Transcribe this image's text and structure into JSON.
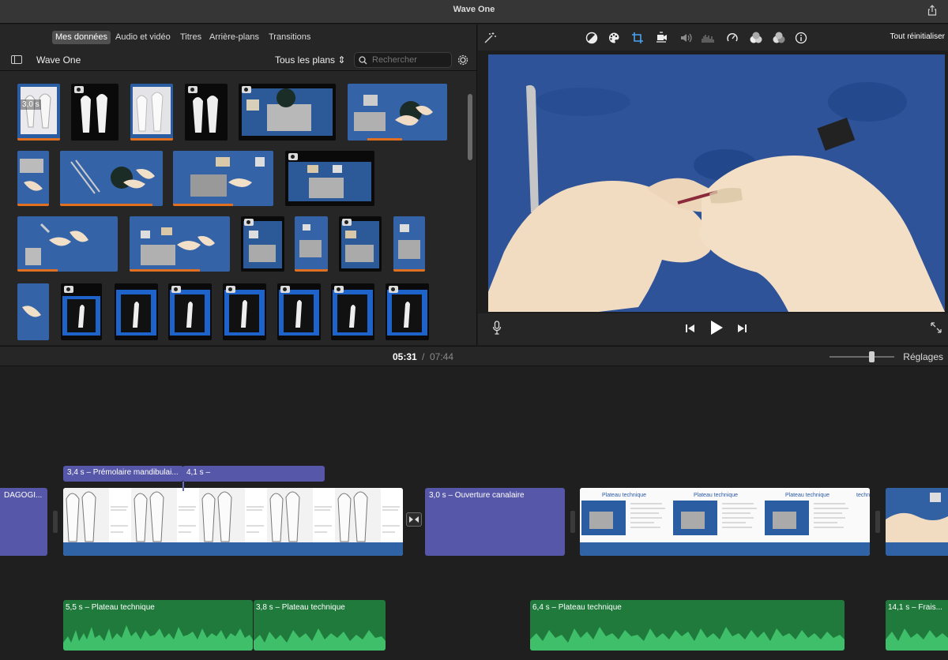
{
  "window": {
    "title": "Wave One"
  },
  "browser": {
    "tabs": [
      "Mes données",
      "Audio et vidéo",
      "Titres",
      "Arrière-plans",
      "Transitions"
    ],
    "active_tab": 0,
    "library_name": "Wave One",
    "filter_label": "Tous les plans",
    "search_placeholder": "Rechercher",
    "first_clip_duration": "3,0 s"
  },
  "viewer": {
    "reset_label": "Tout réinitialiser",
    "tools": [
      "magic-wand-icon",
      "color-balance-icon",
      "color-palette-icon",
      "crop-icon",
      "stabilization-icon",
      "volume-icon",
      "equalizer-icon",
      "speed-icon",
      "noise-reduction-icon",
      "clip-filter-icon",
      "info-icon"
    ]
  },
  "playback": {
    "current": "05:31",
    "separator": "/",
    "total": "07:44"
  },
  "zoom": {
    "settings_label": "Réglages",
    "level": 0.65
  },
  "timeline": {
    "edge_title": "DAGOGI...",
    "title1": "3,4 s – Prémolaire mandibulai...",
    "title2": "4,1 s –",
    "title3": "3,0 s – Ouverture canalaire",
    "plateau_label": "Plateau technique",
    "plateau_label_cut": "techn",
    "audio": [
      {
        "label": "5,5 s – Plateau technique"
      },
      {
        "label": "3,8 s – Plateau technique"
      },
      {
        "label": "6,4 s – Plateau technique"
      },
      {
        "label": "14,1 s – Frais..."
      }
    ]
  },
  "colors": {
    "title_clip": "#5657a8",
    "audio_clip": "#1f7a3c",
    "video_band": "#2f63a6",
    "accent": "#4aa3f0"
  }
}
